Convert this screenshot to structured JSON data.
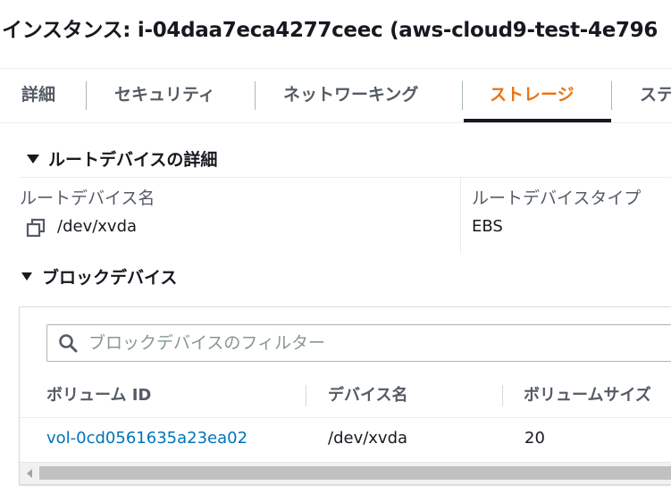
{
  "header": {
    "title": "インスタンス: i-04daa7eca4277ceec (aws-cloud9-test-4e796"
  },
  "tabs": [
    {
      "label": "詳細",
      "active": false
    },
    {
      "label": "セキュリティ",
      "active": false
    },
    {
      "label": "ネットワーキング",
      "active": false
    },
    {
      "label": "ストレージ",
      "active": true
    },
    {
      "label": "ステ",
      "active": false
    }
  ],
  "root_device": {
    "section_title": "ルートデバイスの詳細",
    "name_label": "ルートデバイス名",
    "name_value": "/dev/xvda",
    "type_label": "ルートデバイスタイプ",
    "type_value": "EBS"
  },
  "block_devices": {
    "section_title": "ブロックデバイス",
    "filter_placeholder": "ブロックデバイスのフィルター",
    "filter_value": "",
    "columns": [
      "ボリューム ID",
      "デバイス名",
      "ボリュームサイズ"
    ],
    "rows": [
      {
        "volume_id": "vol-0cd0561635a23ea02",
        "device_name": "/dev/xvda",
        "volume_size": "20"
      }
    ]
  },
  "colors": {
    "accent": "#ec7211",
    "link": "#0073bb",
    "text": "#16191f",
    "muted": "#545b64"
  },
  "icons": {
    "copy": "copy-icon",
    "search": "search-icon",
    "expand": "caret-down-icon"
  }
}
